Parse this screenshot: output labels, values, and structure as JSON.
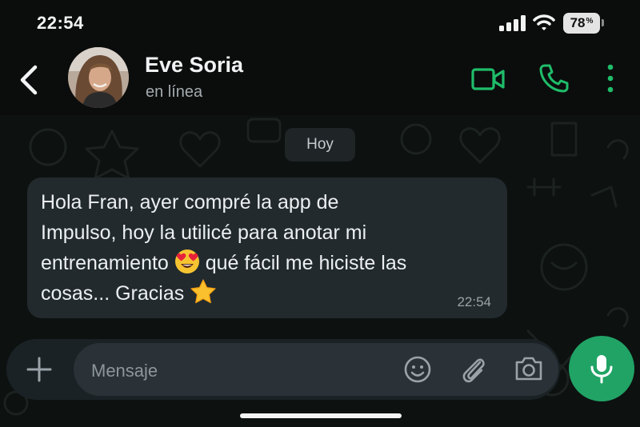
{
  "status_bar": {
    "time": "22:54",
    "battery": "78",
    "battery_unit": "%"
  },
  "header": {
    "contact_name": "Eve Soria",
    "contact_status": "en línea",
    "icons": [
      "back-icon",
      "video-call-icon",
      "phone-icon",
      "more-vertical-icon"
    ],
    "accent_color": "#1fbd6a"
  },
  "chat": {
    "date_separator": "Hoy",
    "messages": [
      {
        "line1": "Hola Fran, ayer compré la app de",
        "line2": "Impulso, hoy la utilicé para anotar mi",
        "line3_a": "entrenamiento",
        "emoji_a": "heart-eyes-emoji",
        "line3_b": "qué fácil me hiciste las",
        "line4": "cosas... Gracias",
        "emoji_b": "star-emoji",
        "time": "22:54"
      }
    ]
  },
  "composer": {
    "placeholder": "Mensaje",
    "icons": [
      "plus-icon",
      "sticker-icon",
      "attach-icon",
      "camera-icon",
      "microphone-icon"
    ],
    "mic_color": "#21a366"
  }
}
